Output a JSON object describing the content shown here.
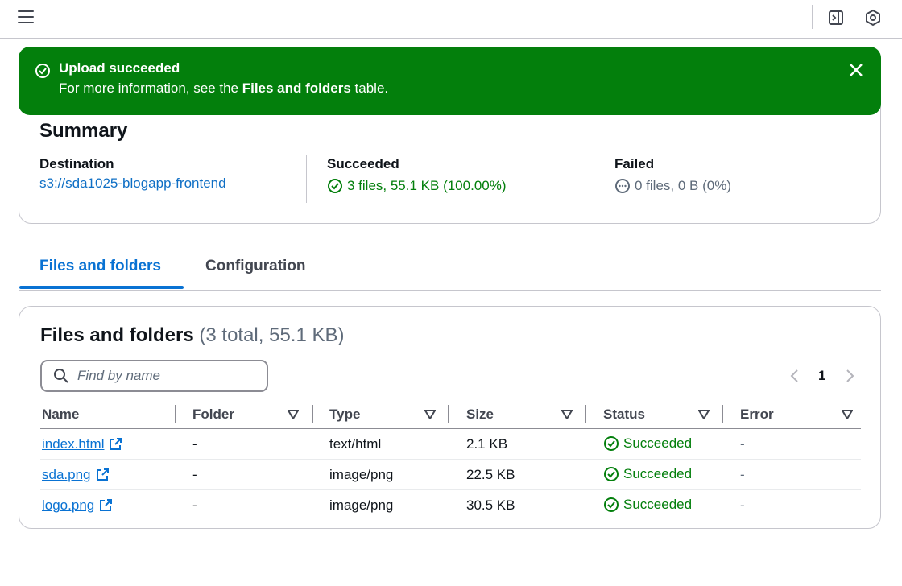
{
  "flash": {
    "title": "Upload succeeded",
    "message_prefix": "For more information, see the ",
    "message_bold": "Files and folders",
    "message_suffix": " table.",
    "color": "#037f0c"
  },
  "summary": {
    "title": "Summary",
    "destination_label": "Destination",
    "destination_value": "s3://sda1025-blogapp-frontend",
    "succeeded_label": "Succeeded",
    "succeeded_value": "3 files, 55.1 KB (100.00%)",
    "failed_label": "Failed",
    "failed_value": "0 files, 0 B (0%)"
  },
  "tabs": [
    {
      "label": "Files and folders",
      "active": true
    },
    {
      "label": "Configuration",
      "active": false
    }
  ],
  "files": {
    "title": "Files and folders",
    "count": "(3 total, 55.1 KB)",
    "search_placeholder": "Find by name",
    "page": "1",
    "columns": [
      "Name",
      "Folder",
      "Type",
      "Size",
      "Status",
      "Error"
    ],
    "rows": [
      {
        "name": "index.html",
        "folder": "-",
        "type": "text/html",
        "size": "2.1 KB",
        "status": "Succeeded",
        "error": "-"
      },
      {
        "name": "sda.png",
        "folder": "-",
        "type": "image/png",
        "size": "22.5 KB",
        "status": "Succeeded",
        "error": "-"
      },
      {
        "name": "logo.png",
        "folder": "-",
        "type": "image/png",
        "size": "30.5 KB",
        "status": "Succeeded",
        "error": "-"
      }
    ]
  },
  "icons": {
    "menu": "hamburger-icon",
    "panel": "side-panel-icon",
    "hex": "hexagon-settings-icon",
    "success": "check-circle-icon",
    "neutral": "ellipsis-circle-icon",
    "external": "external-link-icon"
  },
  "colors": {
    "accent": "#0972d3",
    "success": "#037f0c"
  }
}
